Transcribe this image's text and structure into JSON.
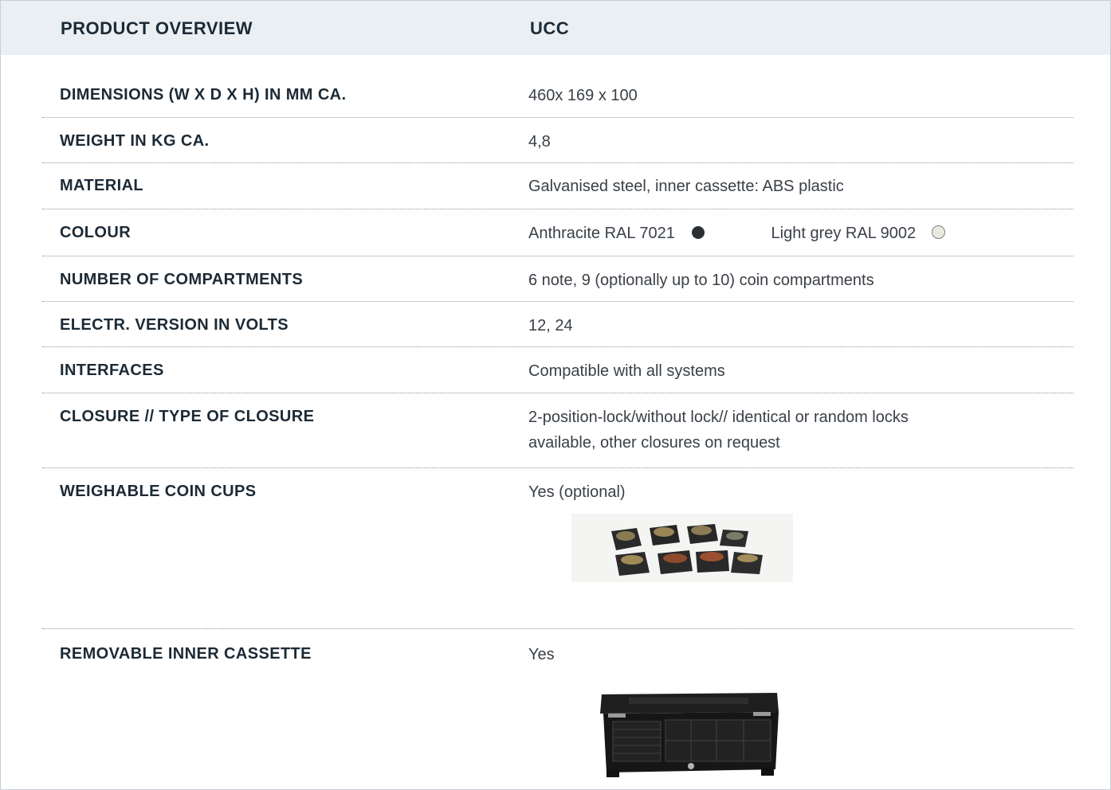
{
  "header": {
    "left_title": "PRODUCT OVERVIEW",
    "right_title": "UCC"
  },
  "rows": [
    {
      "label": "DIMENSIONS (W X D X H) IN MM CA.",
      "value": "460x 169 x 100"
    },
    {
      "label": "WEIGHT IN KG CA.",
      "value": "4,8"
    },
    {
      "label": "MATERIAL",
      "value": "Galvanised steel, inner cassette: ABS plastic"
    },
    {
      "label": "COLOUR",
      "colour_1": "Anthracite RAL 7021",
      "colour_1_hex": "#2b2f33",
      "colour_2": "Light grey RAL 9002",
      "colour_2_hex": "#eceae0"
    },
    {
      "label": "NUMBER OF COMPARTMENTS",
      "value": "6 note, 9 (optionally up to 10) coin compartments"
    },
    {
      "label": "ELECTR. VERSION IN VOLTS",
      "value": "12, 24"
    },
    {
      "label": "INTERFACES",
      "value": "Compatible with all systems"
    },
    {
      "label": "CLOSURE // TYPE OF CLOSURE",
      "value_line1": "2-position-lock/without lock// identical or random locks",
      "value_line2": "available, other closures on request"
    },
    {
      "label": "WEIGHABLE COIN CUPS",
      "value": "Yes (optional)",
      "image": "coin-cups-photo"
    },
    {
      "label": "REMOVABLE INNER CASSETTE",
      "value": "Yes",
      "image": "cash-drawer-cassette-photo"
    }
  ]
}
